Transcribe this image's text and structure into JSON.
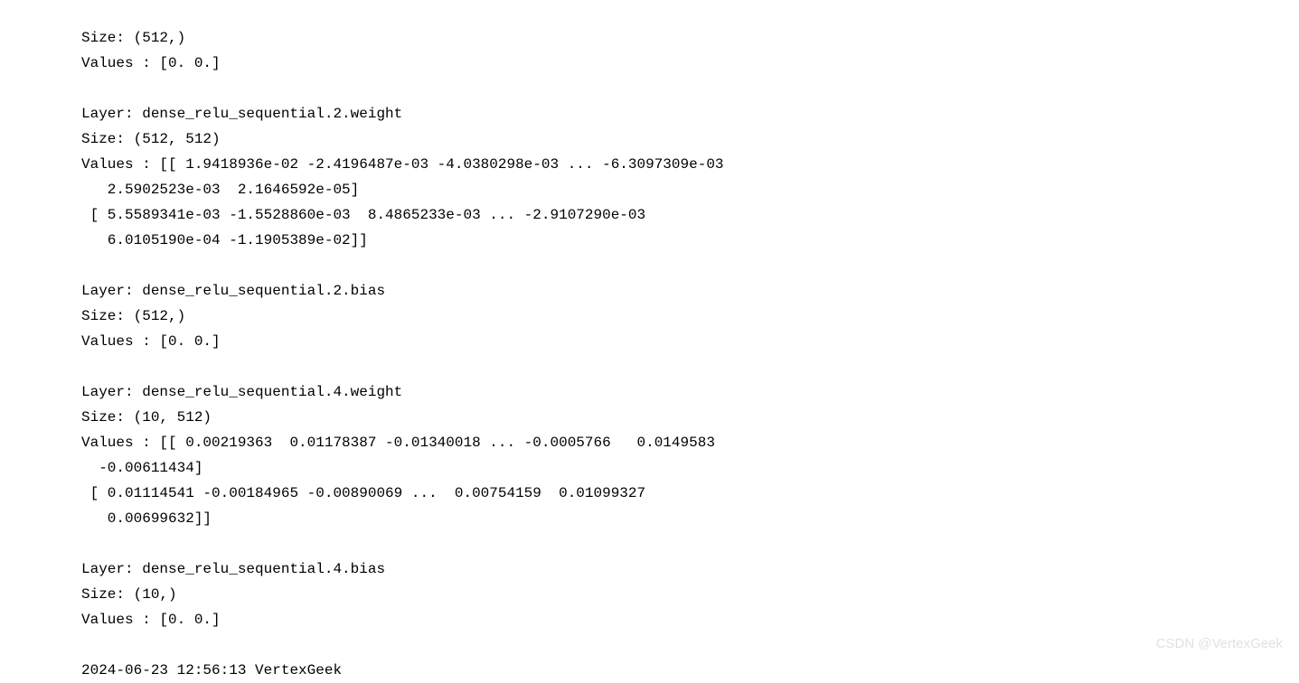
{
  "lines": [
    "Size: (512,)",
    "Values : [0. 0.]",
    "",
    "Layer: dense_relu_sequential.2.weight",
    "Size: (512, 512)",
    "Values : [[ 1.9418936e-02 -2.4196487e-03 -4.0380298e-03 ... -6.3097309e-03",
    "   2.5902523e-03  2.1646592e-05]",
    " [ 5.5589341e-03 -1.5528860e-03  8.4865233e-03 ... -2.9107290e-03",
    "   6.0105190e-04 -1.1905389e-02]]",
    "",
    "Layer: dense_relu_sequential.2.bias",
    "Size: (512,)",
    "Values : [0. 0.]",
    "",
    "Layer: dense_relu_sequential.4.weight",
    "Size: (10, 512)",
    "Values : [[ 0.00219363  0.01178387 -0.01340018 ... -0.0005766   0.0149583",
    "  -0.00611434]",
    " [ 0.01114541 -0.00184965 -0.00890069 ...  0.00754159  0.01099327",
    "   0.00699632]]",
    "",
    "Layer: dense_relu_sequential.4.bias",
    "Size: (10,)",
    "Values : [0. 0.]",
    "",
    "2024-06-23 12:56:13 VertexGeek"
  ],
  "watermark": "CSDN @VertexGeek"
}
